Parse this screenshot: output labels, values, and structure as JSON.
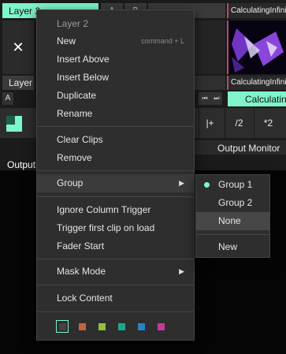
{
  "background": {
    "layer_tab_label": "Layer 2",
    "column_a_label": "A",
    "column_b_label": "B",
    "layer_label": "Layer",
    "clip_close_glyph": "✕",
    "clip_title_top": "CalculatingInfinit...",
    "clip_title_bottom": "CalculatingInfinit...",
    "clip_button_label": "Calculating",
    "deck_label": "A",
    "transport_prev_glyph": "⏮",
    "transport_next_glyph": "⏭",
    "tool_insert": "|+",
    "tool_half": "/2",
    "tool_double": "*2",
    "output_monitor_label": "Output Monitor",
    "output_title": "Output"
  },
  "menu": {
    "title": "Layer 2",
    "new": "New",
    "new_shortcut": "command + L",
    "insert_above": "Insert Above",
    "insert_below": "Insert Below",
    "duplicate": "Duplicate",
    "rename": "Rename",
    "clear_clips": "Clear Clips",
    "remove": "Remove",
    "group": "Group",
    "ignore_column_trigger": "Ignore Column Trigger",
    "trigger_first_clip": "Trigger first clip on load",
    "fader_start": "Fader Start",
    "mask_mode": "Mask Mode",
    "lock_content": "Lock Content",
    "submenu_arrow": "▶",
    "swatches": [
      "#444444",
      "#c4643e",
      "#8fbf3f",
      "#1aa98c",
      "#2a82c4",
      "#c33c9a"
    ]
  },
  "group_submenu": {
    "group1": "Group 1",
    "group2": "Group 2",
    "none": "None",
    "new": "New",
    "selected": "Group 1"
  },
  "colors": {
    "accent": "#7ff5c9",
    "menu_bg": "#2e2e2e",
    "app_bg": "#1b1b1b"
  }
}
